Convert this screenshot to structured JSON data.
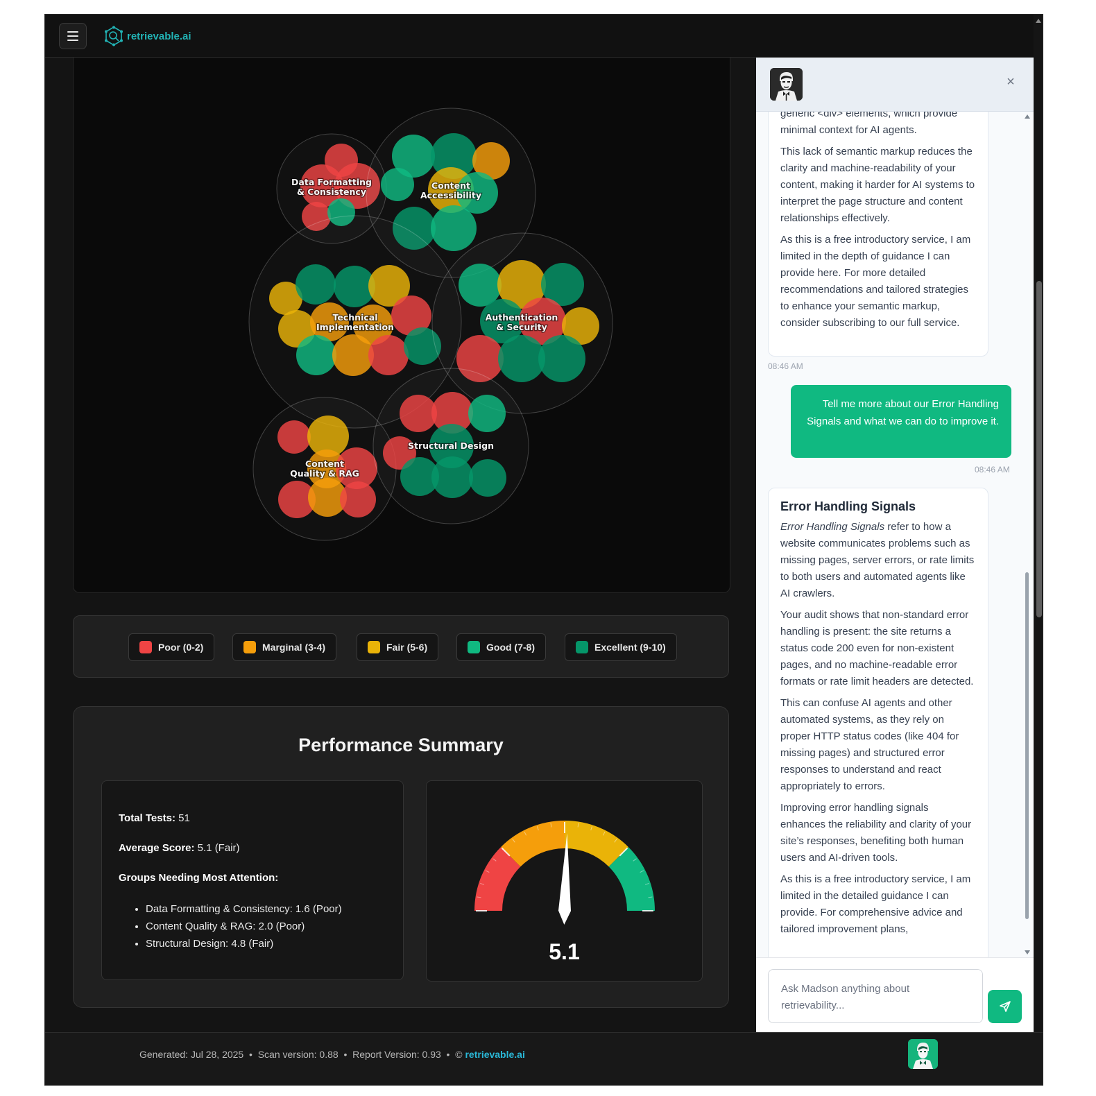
{
  "header": {
    "brand": "retrievable.ai",
    "menu_icon": "hamburger-icon",
    "logo_icon": "network-magnifier-icon"
  },
  "colors": {
    "poor": "#ef4444",
    "marginal": "#f59e0b",
    "fair": "#eab308",
    "good": "#10b981",
    "excellent": "#059669",
    "accent": "#22b3b5"
  },
  "chart_data": {
    "type": "bubble-pack",
    "groups": [
      {
        "name": "Data Formatting & Consistency",
        "lines": [
          "Data Formatting",
          "& Consistency"
        ],
        "tests": [
          "poor",
          "poor",
          "poor",
          "poor",
          "good"
        ]
      },
      {
        "name": "Content Accessibility",
        "lines": [
          "Content",
          "Accessibility"
        ],
        "tests": [
          "good",
          "excellent",
          "marginal",
          "good",
          "fair",
          "good",
          "excellent",
          "good"
        ]
      },
      {
        "name": "Technical Implementation",
        "lines": [
          "Technical",
          "Implementation"
        ],
        "tests": [
          "fair",
          "excellent",
          "excellent",
          "fair",
          "fair",
          "marginal",
          "marginal",
          "poor",
          "good",
          "marginal",
          "poor",
          "excellent"
        ]
      },
      {
        "name": "Authentication & Security",
        "lines": [
          "Authentication",
          "& Security"
        ],
        "tests": [
          "good",
          "fair",
          "excellent",
          "excellent",
          "poor",
          "fair",
          "poor",
          "excellent",
          "excellent"
        ]
      },
      {
        "name": "Content Quality & RAG",
        "lines": [
          "Content",
          "Quality & RAG"
        ],
        "tests": [
          "poor",
          "fair",
          "poor",
          "marginal",
          "poor",
          "marginal",
          "poor"
        ]
      },
      {
        "name": "Structural Design",
        "lines": [
          "Structural Design"
        ],
        "tests": [
          "poor",
          "poor",
          "good",
          "poor",
          "excellent",
          "excellent",
          "excellent",
          "excellent",
          "poor"
        ]
      }
    ]
  },
  "legend": [
    {
      "label": "Poor (0-2)",
      "color": "#ef4444"
    },
    {
      "label": "Marginal (3-4)",
      "color": "#f59e0b"
    },
    {
      "label": "Fair (5-6)",
      "color": "#eab308"
    },
    {
      "label": "Good (7-8)",
      "color": "#10b981"
    },
    {
      "label": "Excellent (9-10)",
      "color": "#059669"
    }
  ],
  "summary": {
    "title": "Performance Summary",
    "total_tests_label": "Total Tests:",
    "total_tests_value": "51",
    "average_label": "Average Score:",
    "average_value": "5.1 (Fair)",
    "attention_label": "Groups Needing Most Attention:",
    "attention": [
      "Data Formatting & Consistency: 1.6 (Poor)",
      "Content Quality & RAG: 2.0 (Poor)",
      "Structural Design: 4.8 (Fair)"
    ],
    "gauge_value": "5.1",
    "gauge_score": 5.1,
    "gauge_max": 10
  },
  "footer": {
    "generated": "Generated: Jul 28, 2025",
    "scan_version": "Scan version: 0.88",
    "report_version": "Report Version: 0.93",
    "copyright": "©",
    "link": "retrievable.ai"
  },
  "chat": {
    "close_icon": "close-icon",
    "msg1_partial_top": "generic <div> elements, which provide",
    "msg1_p1_rest": "minimal context for AI agents.",
    "msg1_p2": "This lack of semantic markup reduces the clarity and machine-readability of your content, making it harder for AI systems to interpret the page structure and content relationships effectively.",
    "msg1_p3": "As this is a free introductory service, I am limited in the depth of guidance I can provide here. For more detailed recommendations and tailored strategies to enhance your semantic markup, consider subscribing to our full service.",
    "msg1_time": "08:46 AM",
    "user_msg": "Tell me more about our Error Handling Signals and what we can do to improve it.",
    "user_time": "08:46 AM",
    "msg2_heading": "Error Handling Signals",
    "msg2_p1_em": "Error Handling Signals",
    "msg2_p1_rest": " refer to how a website communicates problems such as missing pages, server errors, or rate limits to both users and automated agents like AI crawlers.",
    "msg2_p2": "Your audit shows that non-standard error handling is present: the site returns a status code 200 even for non-existent pages, and no machine-readable error formats or rate limit headers are detected.",
    "msg2_p3": "This can confuse AI agents and other automated systems, as they rely on proper HTTP status codes (like 404 for missing pages) and structured error responses to understand and react appropriately to errors.",
    "msg2_p4": "Improving error handling signals enhances the reliability and clarity of your site’s responses, benefiting both human users and AI-driven tools.",
    "msg2_p5": "As this is a free introductory service, I am limited in the detailed guidance I can provide. For comprehensive advice and tailored improvement plans,",
    "input_placeholder": "Ask Madson anything about retrievability...",
    "send_icon": "send-icon"
  }
}
